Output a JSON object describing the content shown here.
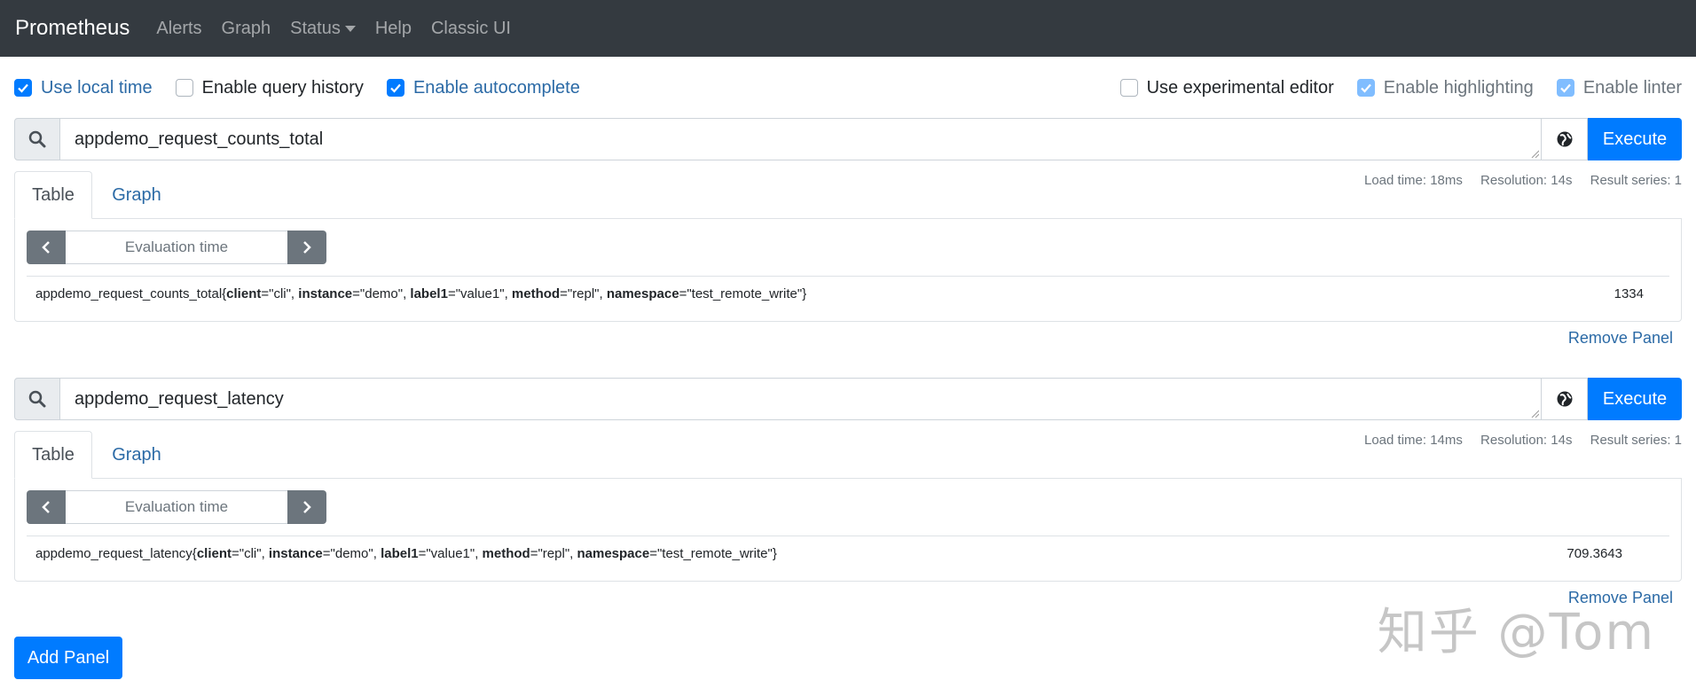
{
  "nav": {
    "brand": "Prometheus",
    "items": [
      {
        "label": "Alerts"
      },
      {
        "label": "Graph"
      },
      {
        "label": "Status"
      },
      {
        "label": "Help"
      },
      {
        "label": "Classic UI"
      }
    ]
  },
  "options": {
    "use_local_time": {
      "label": "Use local time",
      "checked": true
    },
    "enable_query_history": {
      "label": "Enable query history",
      "checked": false
    },
    "enable_autocomplete": {
      "label": "Enable autocomplete",
      "checked": true
    },
    "use_experimental_editor": {
      "label": "Use experimental editor",
      "checked": false
    },
    "enable_highlighting": {
      "label": "Enable highlighting",
      "checked": true
    },
    "enable_linter": {
      "label": "Enable linter",
      "checked": true
    }
  },
  "panels": [
    {
      "query": "appdemo_request_counts_total",
      "execute_label": "Execute",
      "tabs": [
        "Table",
        "Graph"
      ],
      "stats": {
        "load_time": "Load time: 18ms",
        "resolution": "Resolution: 14s",
        "result_series": "Result series: 1"
      },
      "eval_placeholder": "Evaluation time",
      "result": {
        "metric": "appdemo_request_counts_total",
        "open": "{",
        "labels": [
          {
            "key": "client",
            "value": "=\"cli\", "
          },
          {
            "key": "instance",
            "value": "=\"demo\", "
          },
          {
            "key": "label1",
            "value": "=\"value1\", "
          },
          {
            "key": "method",
            "value": "=\"repl\", "
          },
          {
            "key": "namespace",
            "value": "=\"test_remote_write\""
          }
        ],
        "close": "}",
        "value": "1334"
      },
      "remove_label": "Remove Panel"
    },
    {
      "query": "appdemo_request_latency",
      "execute_label": "Execute",
      "tabs": [
        "Table",
        "Graph"
      ],
      "stats": {
        "load_time": "Load time: 14ms",
        "resolution": "Resolution: 14s",
        "result_series": "Result series: 1"
      },
      "eval_placeholder": "Evaluation time",
      "result": {
        "metric": "appdemo_request_latency",
        "open": "{",
        "labels": [
          {
            "key": "client",
            "value": "=\"cli\", "
          },
          {
            "key": "instance",
            "value": "=\"demo\", "
          },
          {
            "key": "label1",
            "value": "=\"value1\", "
          },
          {
            "key": "method",
            "value": "=\"repl\", "
          },
          {
            "key": "namespace",
            "value": "=\"test_remote_write\""
          }
        ],
        "close": "}",
        "value": "709.3643"
      },
      "remove_label": "Remove Panel"
    }
  ],
  "add_panel_label": "Add Panel",
  "watermark": "知乎 @Tom",
  "colors": {
    "accent": "#007bff",
    "navbar": "#343a40",
    "link": "#2b6aa6",
    "secondary": "#6c757d"
  },
  "icons": {
    "search": "search-icon",
    "globe": "globe-icon",
    "prev": "chevron-left-icon",
    "next": "chevron-right-icon",
    "check": "check-icon"
  }
}
